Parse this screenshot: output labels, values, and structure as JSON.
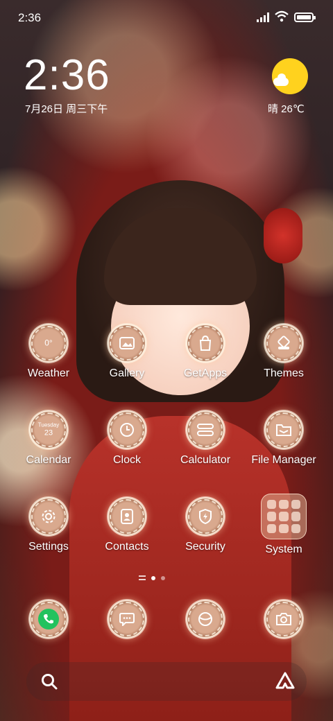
{
  "status": {
    "time": "2:36"
  },
  "lockscreen": {
    "clock": "2:36",
    "date": "7月26日 周三下午",
    "weather": "晴 26℃"
  },
  "apps": {
    "row1": [
      {
        "label": "Weather",
        "glyph": "0°"
      },
      {
        "label": "Gallery"
      },
      {
        "label": "GetApps"
      },
      {
        "label": "Themes"
      }
    ],
    "row2": [
      {
        "label": "Calendar",
        "glyph_line1": "Tuesday",
        "glyph_line2": "23"
      },
      {
        "label": "Clock"
      },
      {
        "label": "Calculator"
      },
      {
        "label": "File Manager"
      }
    ],
    "row3": [
      {
        "label": "Settings"
      },
      {
        "label": "Contacts"
      },
      {
        "label": "Security"
      },
      {
        "label": "System"
      }
    ]
  },
  "dock": [
    {
      "name": "Phone"
    },
    {
      "name": "Messages"
    },
    {
      "name": "Browser"
    },
    {
      "name": "Camera"
    }
  ],
  "icons": {
    "weather": "sun-cloud-icon",
    "gallery": "image-icon",
    "getapps": "shopping-bag-icon",
    "themes": "brush-icon",
    "calendar": "calendar-icon",
    "clock": "clock-icon",
    "calculator": "calculator-icon",
    "filemanager": "folder-icon",
    "settings": "gear-icon",
    "contacts": "contact-card-icon",
    "security": "shield-bolt-icon",
    "system": "app-folder-icon",
    "phone": "phone-icon",
    "messages": "message-bubble-icon",
    "browser": "globe-icon",
    "camera": "camera-icon",
    "search": "search-icon",
    "assistant": "alpha-triangle-icon"
  },
  "colors": {
    "accent": "#ffd21e",
    "phone": "#22c25e",
    "wallpaper_red": "#8e2018"
  }
}
